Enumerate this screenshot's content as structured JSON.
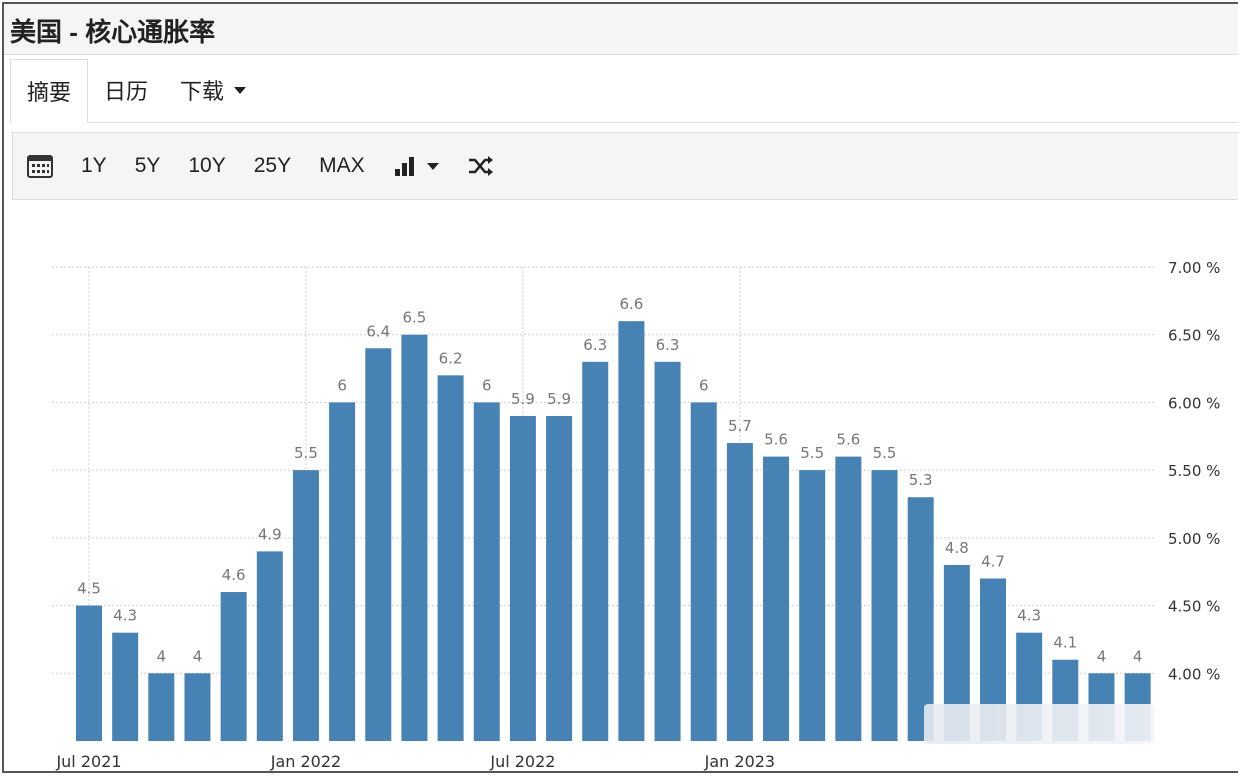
{
  "page_title": "美国 - 核心通胀率",
  "tabs": [
    {
      "label": "摘要",
      "active": true
    },
    {
      "label": "日历",
      "active": false
    },
    {
      "label": "下载",
      "active": false,
      "has_dropdown": true
    }
  ],
  "toolbar": {
    "ranges": [
      "1Y",
      "5Y",
      "10Y",
      "25Y",
      "MAX"
    ],
    "icons": [
      "calendar-icon",
      "bar-chart-icon",
      "chevron-down-icon",
      "shuffle-icon"
    ]
  },
  "colors": {
    "bar": "#4682b4",
    "grid": "#cfcfcf",
    "label": "#777777",
    "axis_text": "#333333"
  },
  "chart_data": {
    "type": "bar",
    "categories": [
      "2021-07",
      "2021-08",
      "2021-09",
      "2021-10",
      "2021-11",
      "2021-12",
      "2022-01",
      "2022-02",
      "2022-03",
      "2022-04",
      "2022-05",
      "2022-06",
      "2022-07",
      "2022-08",
      "2022-09",
      "2022-10",
      "2022-11",
      "2022-12",
      "2023-01",
      "2023-02",
      "2023-03",
      "2023-04",
      "2023-05",
      "2023-06",
      "2023-07",
      "2023-08",
      "2023-09",
      "2023-10",
      "2023-11",
      "2023-12"
    ],
    "values": [
      4.5,
      4.3,
      4,
      4,
      4.6,
      4.9,
      5.5,
      6,
      6.4,
      6.5,
      6.2,
      6,
      5.9,
      5.9,
      6.3,
      6.6,
      6.3,
      6,
      5.7,
      5.6,
      5.5,
      5.6,
      5.5,
      5.3,
      4.8,
      4.7,
      4.3,
      4.1,
      4,
      4
    ],
    "data_labels": [
      "4.5",
      "4.3",
      "4",
      "4",
      "4.6",
      "4.9",
      "5.5",
      "6",
      "6.4",
      "6.5",
      "6.2",
      "6",
      "5.9",
      "5.9",
      "6.3",
      "6.6",
      "6.3",
      "6",
      "5.7",
      "5.6",
      "5.5",
      "5.6",
      "5.5",
      "5.3",
      "4.8",
      "4.7",
      "4.3",
      "4.1",
      "4",
      "4"
    ],
    "x_tick_labels": [
      {
        "label": "Jul 2021",
        "category": "2021-07"
      },
      {
        "label": "Jan 2022",
        "category": "2022-01"
      },
      {
        "label": "Jul 2022",
        "category": "2022-07"
      },
      {
        "label": "Jan 2023",
        "category": "2023-01"
      }
    ],
    "y_ticks": [
      {
        "value": 4.0,
        "label": "4.00 %"
      },
      {
        "value": 4.5,
        "label": "4.50 %"
      },
      {
        "value": 5.0,
        "label": "5.00 %"
      },
      {
        "value": 5.5,
        "label": "5.50 %"
      },
      {
        "value": 6.0,
        "label": "6.00 %"
      },
      {
        "value": 6.5,
        "label": "6.50 %"
      },
      {
        "value": 7.0,
        "label": "7.00 %"
      }
    ],
    "ylim": [
      3.5,
      7.0
    ],
    "y_axis_position": "right",
    "grid": true,
    "title": "",
    "xlabel": "",
    "ylabel": ""
  }
}
